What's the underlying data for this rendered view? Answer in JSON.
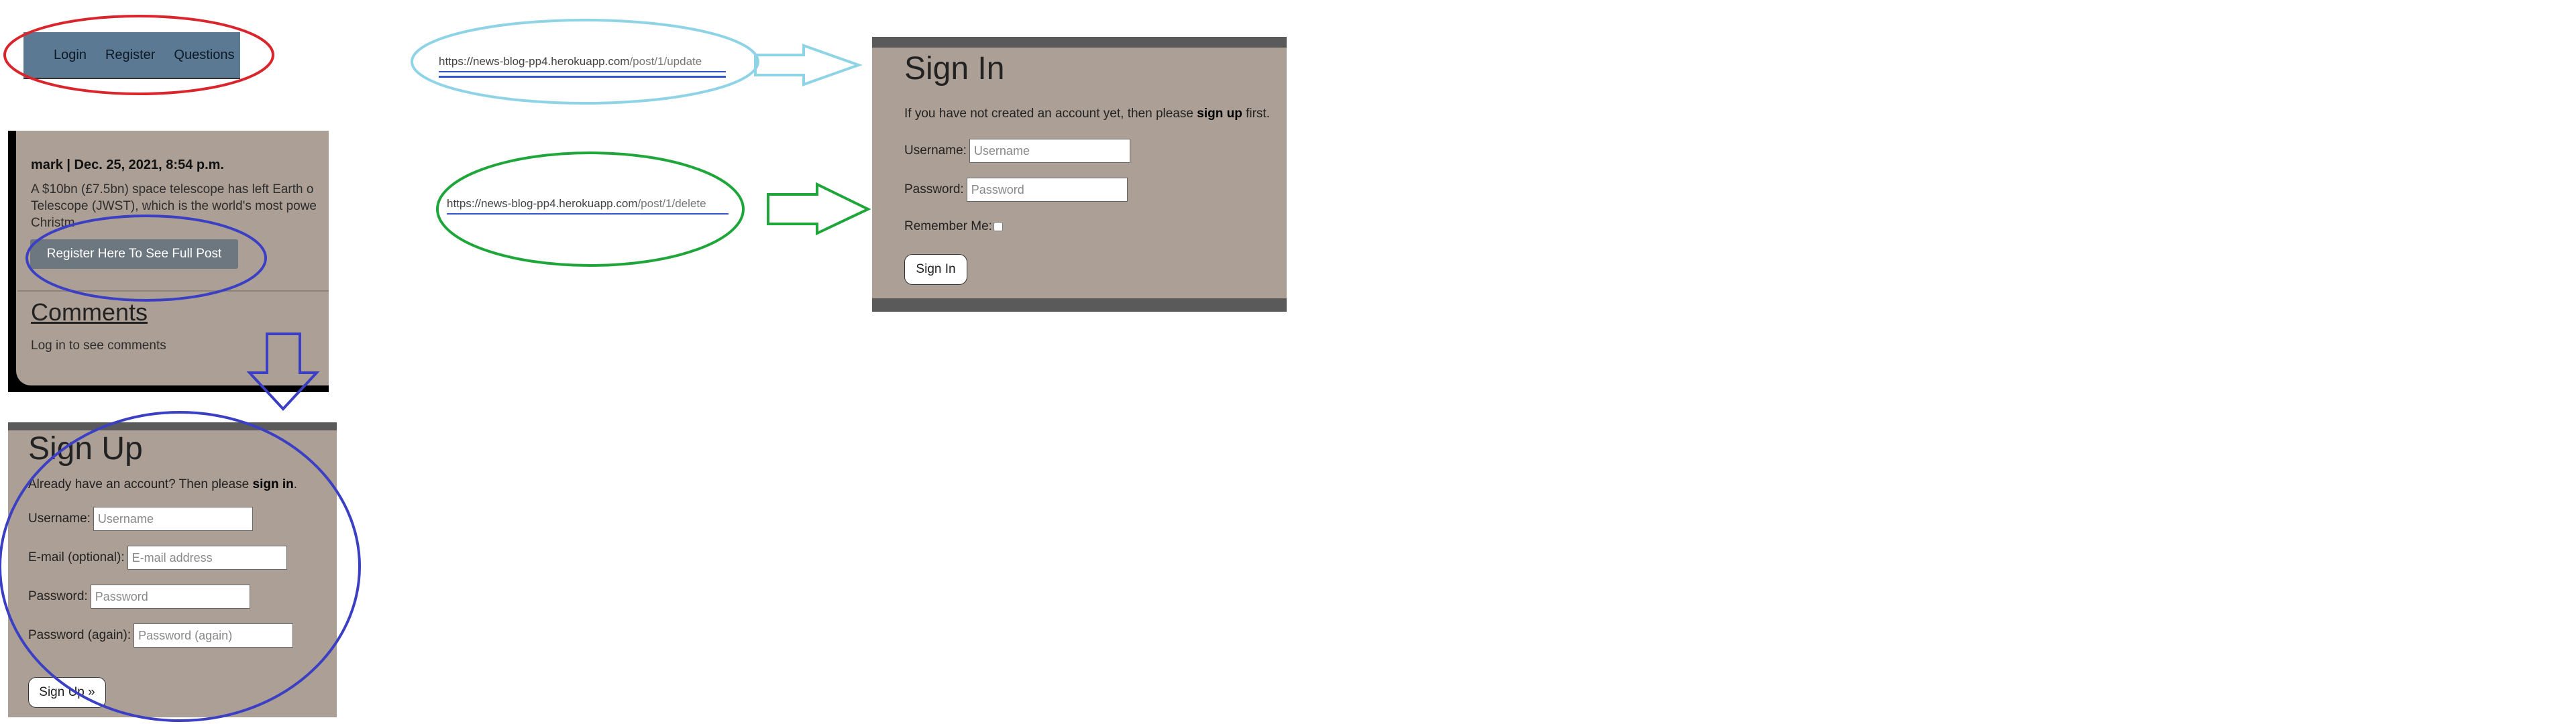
{
  "nav": {
    "links": [
      "Login",
      "Register",
      "Questions"
    ]
  },
  "post": {
    "meta": "mark | Dec. 25, 2021, 8:54 p.m.",
    "excerpt_line1": "A $10bn (£7.5bn) space telescope has left Earth o",
    "excerpt_line2": "Telescope (JWST), which is the world's most powe",
    "excerpt_line3": "Christm",
    "register_button": "Register Here To See Full Post",
    "comments_heading": "Comments",
    "comments_note": "Log in to see comments"
  },
  "signup": {
    "title": "Sign Up",
    "note_prefix": "Already have an account? Then please ",
    "note_link": "sign in",
    "note_suffix": ".",
    "username_label": "Username:",
    "username_placeholder": "Username",
    "email_label": "E-mail (optional):",
    "email_placeholder": "E-mail address",
    "password_label": "Password:",
    "password_placeholder": "Password",
    "password2_label": "Password (again):",
    "password2_placeholder": "Password (again)",
    "submit": "Sign Up »"
  },
  "urls": {
    "update_host": "https://news-blog-pp4.herokuapp.com",
    "update_path": "/post/1/update",
    "delete_host": "https://news-blog-pp4.herokuapp.com",
    "delete_path": "/post/1/delete"
  },
  "signin": {
    "title": "Sign In",
    "note_prefix": "If you have not created an account yet, then please ",
    "note_link": "sign up",
    "note_suffix": " first.",
    "username_label": "Username:",
    "username_placeholder": "Username",
    "password_label": "Password:",
    "password_placeholder": "Password",
    "remember_label": "Remember Me:",
    "submit": "Sign In"
  },
  "colors": {
    "panel_bg": "#ac9f95",
    "nav_bg": "#5b7993",
    "annotation_red": "#d9252b",
    "annotation_blue": "#3b3fc4",
    "annotation_lightblue": "#8fd3e6",
    "annotation_green": "#1fa63a"
  }
}
